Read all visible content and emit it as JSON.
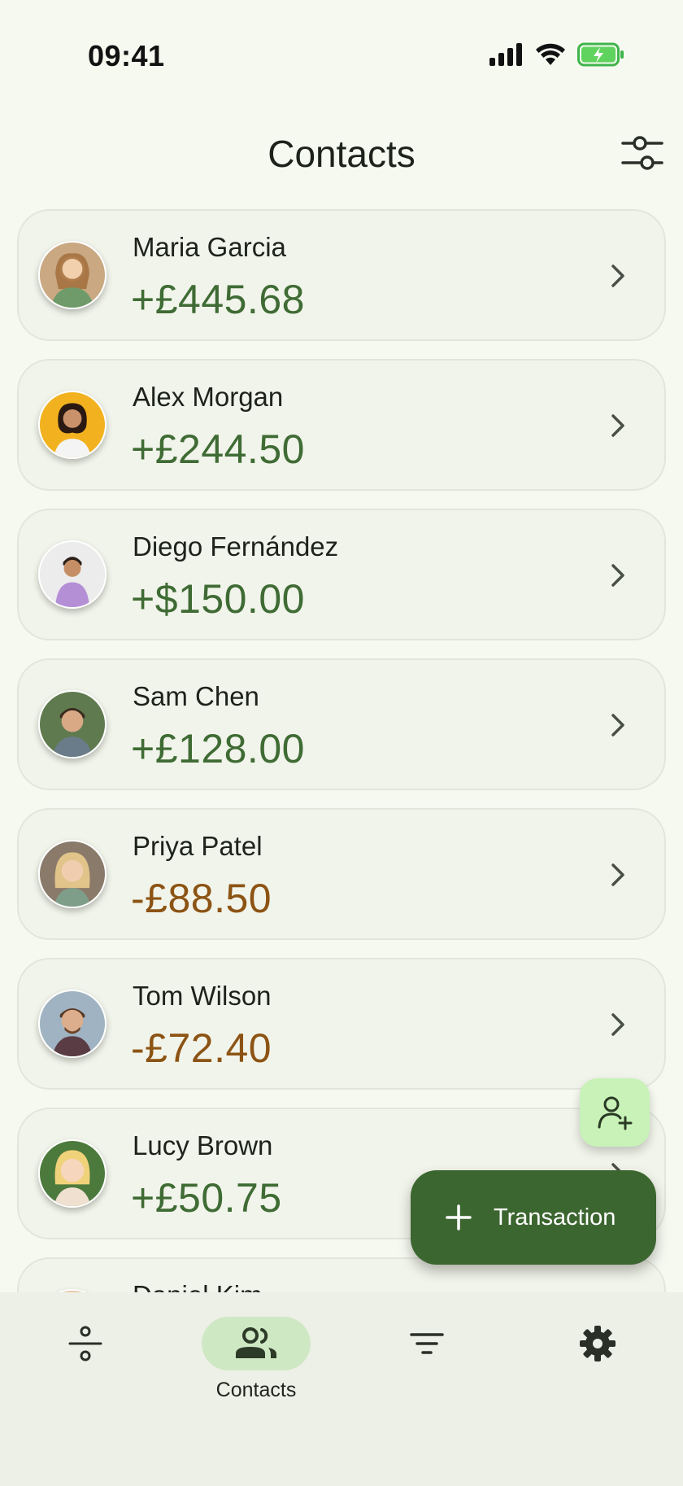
{
  "status": {
    "time": "09:41"
  },
  "header": {
    "title": "Contacts"
  },
  "contacts": [
    {
      "name": "Maria Garcia",
      "amount": "+£445.68",
      "sign": "pos"
    },
    {
      "name": "Alex Morgan",
      "amount": "+£244.50",
      "sign": "pos"
    },
    {
      "name": "Diego Fernández",
      "amount": "+$150.00",
      "sign": "pos"
    },
    {
      "name": "Sam Chen",
      "amount": "+£128.00",
      "sign": "pos"
    },
    {
      "name": "Priya Patel",
      "amount": "-£88.50",
      "sign": "neg"
    },
    {
      "name": "Tom Wilson",
      "amount": "-£72.40",
      "sign": "neg"
    },
    {
      "name": "Lucy Brown",
      "amount": "+£50.75",
      "sign": "pos"
    },
    {
      "name": "Daniel Kim",
      "amount": "",
      "sign": "pos"
    }
  ],
  "fab": {
    "transaction_label": "Transaction"
  },
  "nav": {
    "items": [
      {
        "id": "balance",
        "label": "",
        "icon": "divide-icon"
      },
      {
        "id": "contacts",
        "label": "Contacts",
        "icon": "people-icon",
        "active": true
      },
      {
        "id": "filter",
        "label": "",
        "icon": "filter-lines-icon"
      },
      {
        "id": "settings",
        "label": "",
        "icon": "gear-icon"
      }
    ]
  },
  "colors": {
    "positive": "#3f6b34",
    "negative": "#8c5314",
    "primary": "#3c6630",
    "accent_light": "#c8f2b8",
    "background": "#f6f9f0"
  }
}
